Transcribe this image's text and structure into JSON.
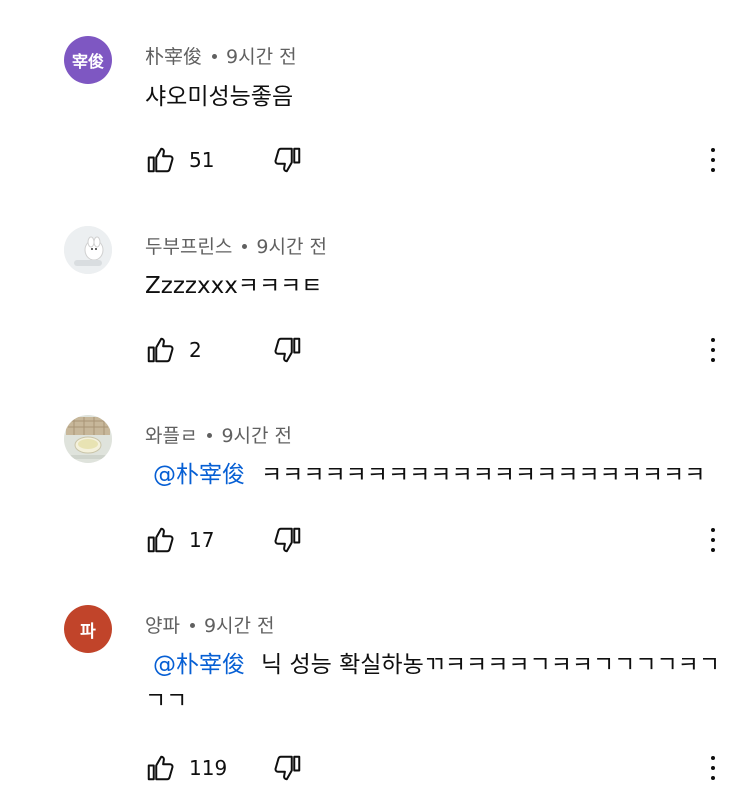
{
  "comments": [
    {
      "author": "朴宰俊",
      "time": "9시간 전",
      "avatar_text": "宰俊",
      "mention": "",
      "body": "샤오미성능좋음",
      "likes": "51"
    },
    {
      "author": "두부프린스",
      "time": "9시간 전",
      "avatar_text": "",
      "mention": "",
      "body": "Zzzzxxxㅋㅋㅋㅌ",
      "likes": "2"
    },
    {
      "author": "와플ㄹ",
      "time": "9시간 전",
      "avatar_text": "",
      "mention": "@朴宰俊",
      "body": "ㅋㅋㅋㅋㅋㅋㅋㅋㅋㅋㅋㅋㅋㅋㅋㅋㅋㅋㅋㅋㅋ",
      "likes": "17"
    },
    {
      "author": "양파",
      "time": "9시간 전",
      "avatar_text": "파",
      "mention": "@朴宰俊",
      "body": "닉 성능 확실하농ㄲㅋㅋㅋㅋㄱㅋㅋㄱㄱㄱㄱㅋㄱㄱㄱ",
      "likes": "119"
    }
  ],
  "colors": {
    "avatar_1": "#7e57c2",
    "avatar_4": "#c1442a",
    "mention": "#065fd4",
    "meta": "#606060"
  },
  "icons": [
    "thumbs-up-icon",
    "thumbs-down-icon",
    "more-vert-icon"
  ]
}
